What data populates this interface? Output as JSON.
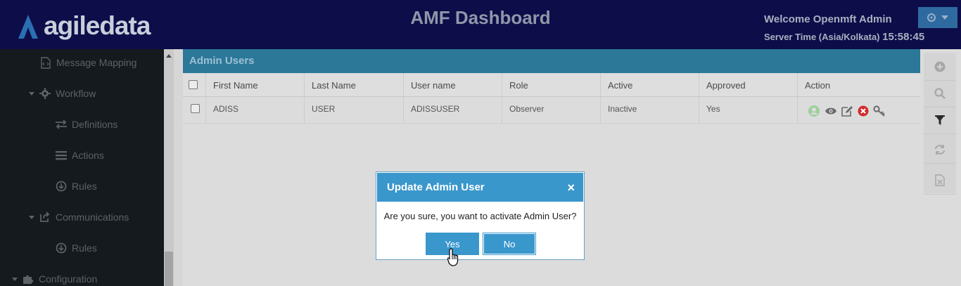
{
  "header": {
    "logo_text": "agiledata",
    "title": "AMF Dashboard",
    "welcome": "Welcome Openmft Admin",
    "server_time_label": "Server Time (Asia/Kolkata)",
    "server_time_value": "15:58:45"
  },
  "sidebar": {
    "items": [
      {
        "label": "Message Mapping",
        "icon": "code-file-icon"
      },
      {
        "label": "Workflow",
        "icon": "gear-icon"
      },
      {
        "label": "Definitions",
        "icon": "swap-icon"
      },
      {
        "label": "Actions",
        "icon": "list-icon"
      },
      {
        "label": "Rules",
        "icon": "rules-icon"
      },
      {
        "label": "Communications",
        "icon": "share-icon"
      },
      {
        "label": "Rules",
        "icon": "rules-icon"
      },
      {
        "label": "Configuration",
        "icon": "puzzle-icon"
      }
    ]
  },
  "panel": {
    "title": "Admin Users"
  },
  "table": {
    "columns": [
      "First Name",
      "Last Name",
      "User name",
      "Role",
      "Active",
      "Approved",
      "Action"
    ],
    "rows": [
      {
        "first_name": "ADISS",
        "last_name": "USER",
        "username": "ADISSUSER",
        "role": "Observer",
        "active": "Inactive",
        "approved": "Yes"
      }
    ]
  },
  "toolbar": [
    "add-icon",
    "search-icon",
    "filter-icon",
    "refresh-icon",
    "export-excel-icon"
  ],
  "dialog": {
    "title": "Update Admin User",
    "close": "×",
    "message": "Are you sure, you want to activate Admin User?",
    "yes_label": "Yes",
    "no_label": "No"
  },
  "colors": {
    "header_bg": "#0d0d4a",
    "sidebar_bg": "#141a1d",
    "panel_title_bg": "#2b7899",
    "dialog_accent": "#3a97cc",
    "user_menu_bg": "#2e6aa0"
  }
}
